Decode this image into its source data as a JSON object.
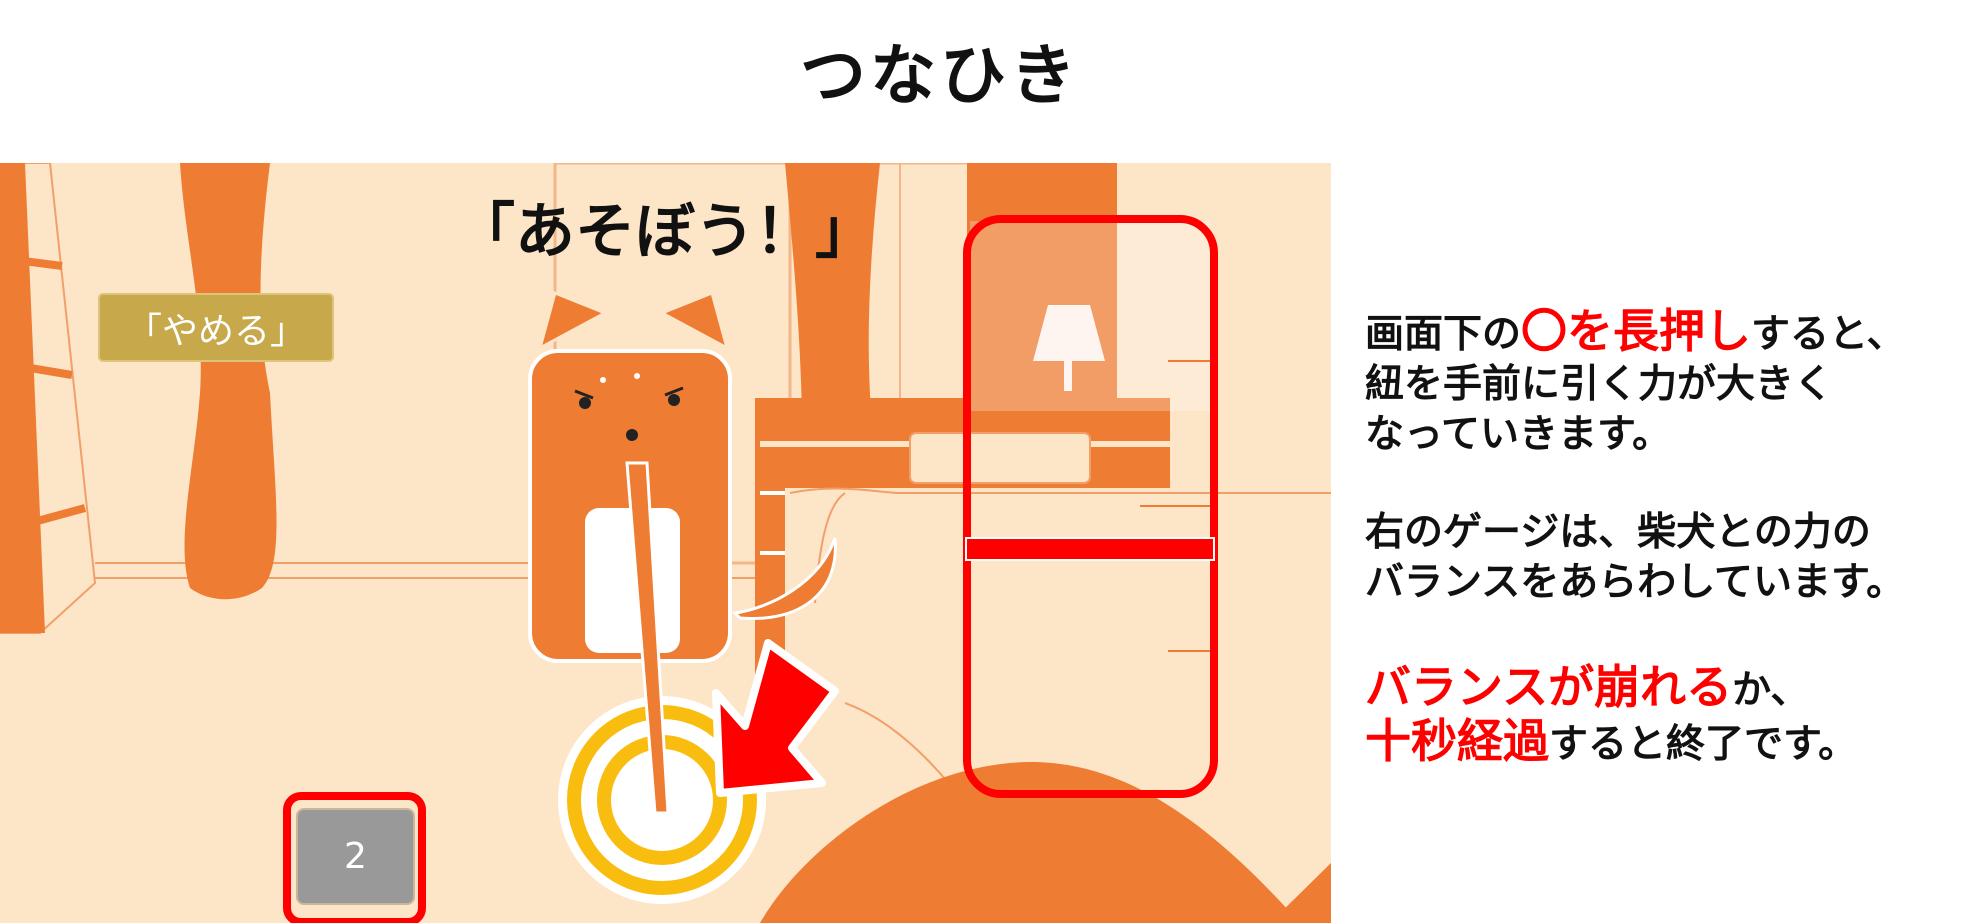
{
  "page": {
    "title": "つなひき"
  },
  "game": {
    "speech": "「あそぼう！」",
    "quit_button_label": "「やめる」",
    "counter_value": "2"
  },
  "instructions": {
    "block1": {
      "line1_pre": "画面下の",
      "line1_hl": "〇を長押し",
      "line1_post": "すると、",
      "line2": "紐を手前に引く力が大きく",
      "line3": "なっていきます。"
    },
    "block2": {
      "line1": "右のゲージは、柴犬との力の",
      "line2": "バランスをあらわしています。"
    },
    "block3": {
      "line1_hl": "バランスが崩れる",
      "line1_post": "か、",
      "line2_hl": "十秒経過",
      "line2_post": "すると終了です。"
    }
  },
  "colors": {
    "background": "#fde5c8",
    "orange": "#ee7c33",
    "gold": "#c7a94c",
    "highlight_red": "#ff0000",
    "ring_yellow": "#f9bd10"
  },
  "icons": [
    "shiba-dog-icon",
    "rope-icon",
    "pull-circle-icon",
    "arrow-pointer-icon",
    "lamp-icon"
  ]
}
